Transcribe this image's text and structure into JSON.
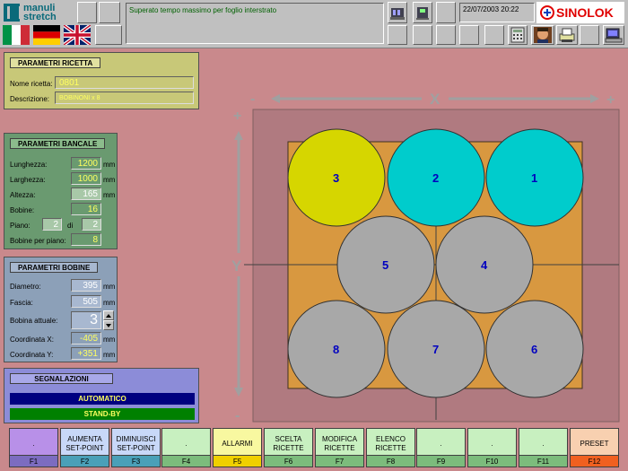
{
  "header": {
    "logo_line1": "manuli",
    "logo_line2": "stretch",
    "message": "Superato tempo massimo per foglio interstrato",
    "datetime": "22/07/2003  20:22",
    "brand": "SINOLOK"
  },
  "ricetta": {
    "title": "PARAMETRI RICETTA",
    "nome_label": "Nome ricetta:",
    "nome_value": "0801",
    "descr_label": "Descrizione:",
    "descr_value": "BOBINONI x 8"
  },
  "bancale": {
    "title": "PARAMETRI BANCALE",
    "lunghezza_label": "Lunghezza:",
    "lunghezza_value": "1200",
    "larghezza_label": "Larghezza:",
    "larghezza_value": "1000",
    "altezza_label": "Altezza:",
    "altezza_value": "165",
    "bobine_label": "Bobine:",
    "bobine_value": "16",
    "piano_label": "Piano:",
    "piano_value": "2",
    "di_label": "di",
    "piano_tot": "2",
    "per_piano_label": "Bobine per piano:",
    "per_piano_value": "8",
    "unit": "mm"
  },
  "bobine": {
    "title": "PARAMETRI BOBINE",
    "diametro_label": "Diametro:",
    "diametro_value": "395",
    "fascia_label": "Fascia:",
    "fascia_value": "505",
    "attuale_label": "Bobina attuale:",
    "attuale_value": "3",
    "coordx_label": "Coordinata X:",
    "coordx_value": "-405",
    "coordy_label": "Coordinata Y:",
    "coordy_value": "+351",
    "unit": "mm"
  },
  "segnalazioni": {
    "title": "SEGNALAZIONI",
    "mode": "AUTOMATICO",
    "state": "STAND-BY"
  },
  "axes": {
    "x_label": "X",
    "y_label": "Y",
    "minus": "-",
    "plus": "+"
  },
  "pallet": {
    "bobbins": [
      {
        "id": "3",
        "color": "#d6d600"
      },
      {
        "id": "2",
        "color": "#00cccc"
      },
      {
        "id": "1",
        "color": "#00cccc"
      },
      {
        "id": "5",
        "color": "#a8a8a8"
      },
      {
        "id": "4",
        "color": "#a8a8a8"
      },
      {
        "id": "8",
        "color": "#a8a8a8"
      },
      {
        "id": "7",
        "color": "#a8a8a8"
      },
      {
        "id": "6",
        "color": "#a8a8a8"
      }
    ]
  },
  "fkeys": [
    {
      "label": ".",
      "num": "F1",
      "color": "#b890e8",
      "numcolor": "#7c6cc0"
    },
    {
      "label": "AUMENTA SET-POINT",
      "num": "F2",
      "color": "#c8d8f8",
      "numcolor": "#4aa0b8"
    },
    {
      "label": "DIMINUISCI SET-POINT",
      "num": "F3",
      "color": "#c8d8f8",
      "numcolor": "#4aa0b8"
    },
    {
      "label": ".",
      "num": "F4",
      "color": "#c8f0c0",
      "numcolor": "#7cbc7c"
    },
    {
      "label": "ALLARMI",
      "num": "F5",
      "color": "#f8f8a0",
      "numcolor": "#f0d000"
    },
    {
      "label": "SCELTA RICETTE",
      "num": "F6",
      "color": "#c8f0c0",
      "numcolor": "#7cbc7c"
    },
    {
      "label": "MODIFICA RICETTE",
      "num": "F7",
      "color": "#c8f0c0",
      "numcolor": "#7cbc7c"
    },
    {
      "label": "ELENCO RICETTE",
      "num": "F8",
      "color": "#c8f0c0",
      "numcolor": "#7cbc7c"
    },
    {
      "label": ".",
      "num": "F9",
      "color": "#c8f0c0",
      "numcolor": "#7cbc7c"
    },
    {
      "label": ".",
      "num": "F10",
      "color": "#c8f0c0",
      "numcolor": "#7cbc7c"
    },
    {
      "label": ".",
      "num": "F11",
      "color": "#c8f0c0",
      "numcolor": "#7cbc7c"
    },
    {
      "label": "PRESET",
      "num": "F12",
      "color": "#f8d0b0",
      "numcolor": "#f06020"
    }
  ]
}
